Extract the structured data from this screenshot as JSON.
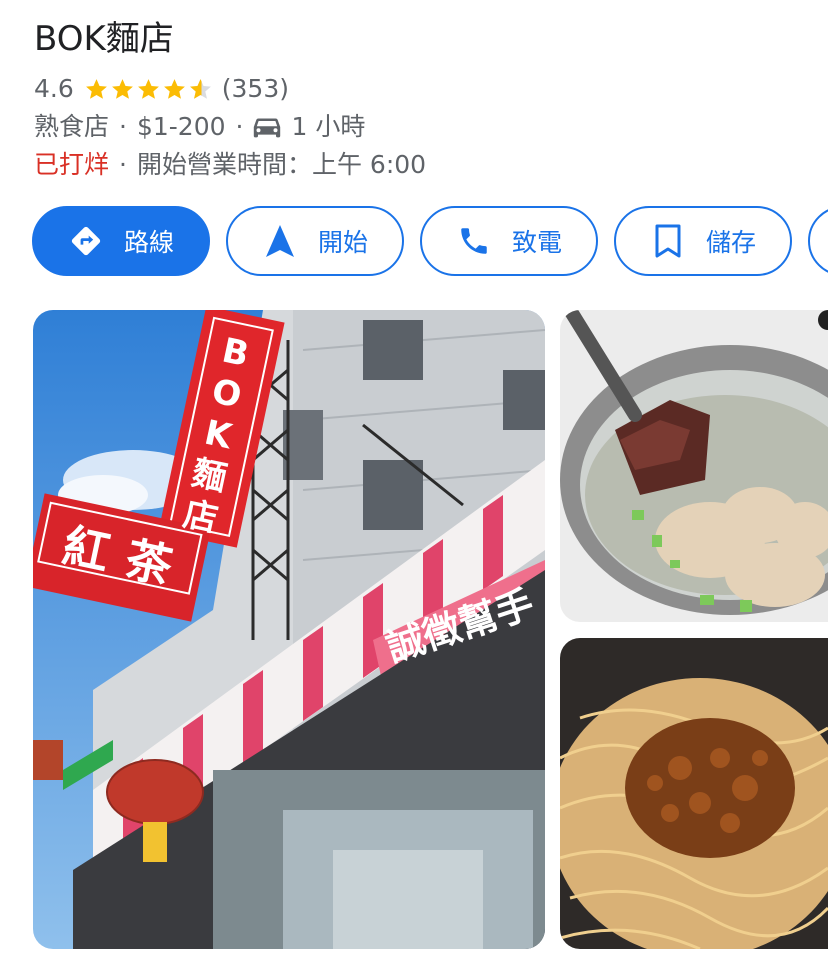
{
  "place": {
    "name": "BOK麵店",
    "rating": "4.6",
    "stars_value": 4.6,
    "review_count": "(353)",
    "category": "熟食店",
    "price": "$1-200",
    "drive_time": "1 小時",
    "status": "已打烊",
    "opening": "開始營業時間：上午 6:00",
    "separator": "·"
  },
  "actions": [
    {
      "label": "路線",
      "icon": "directions-icon"
    },
    {
      "label": "開始",
      "icon": "navigation-arrow-icon"
    },
    {
      "label": "致電",
      "icon": "phone-icon"
    },
    {
      "label": "儲存",
      "icon": "bookmark-icon"
    }
  ],
  "photos": {
    "storefront": {
      "sign_vertical": "BOK麵店",
      "sign_horizontal": "紅茶",
      "banner": "誠徵幫手"
    },
    "soup": {},
    "noodles": {}
  },
  "colors": {
    "accent": "#1a73e8",
    "star": "#fbbc04",
    "closed": "#d93025",
    "secondary_text": "#5f6368"
  }
}
